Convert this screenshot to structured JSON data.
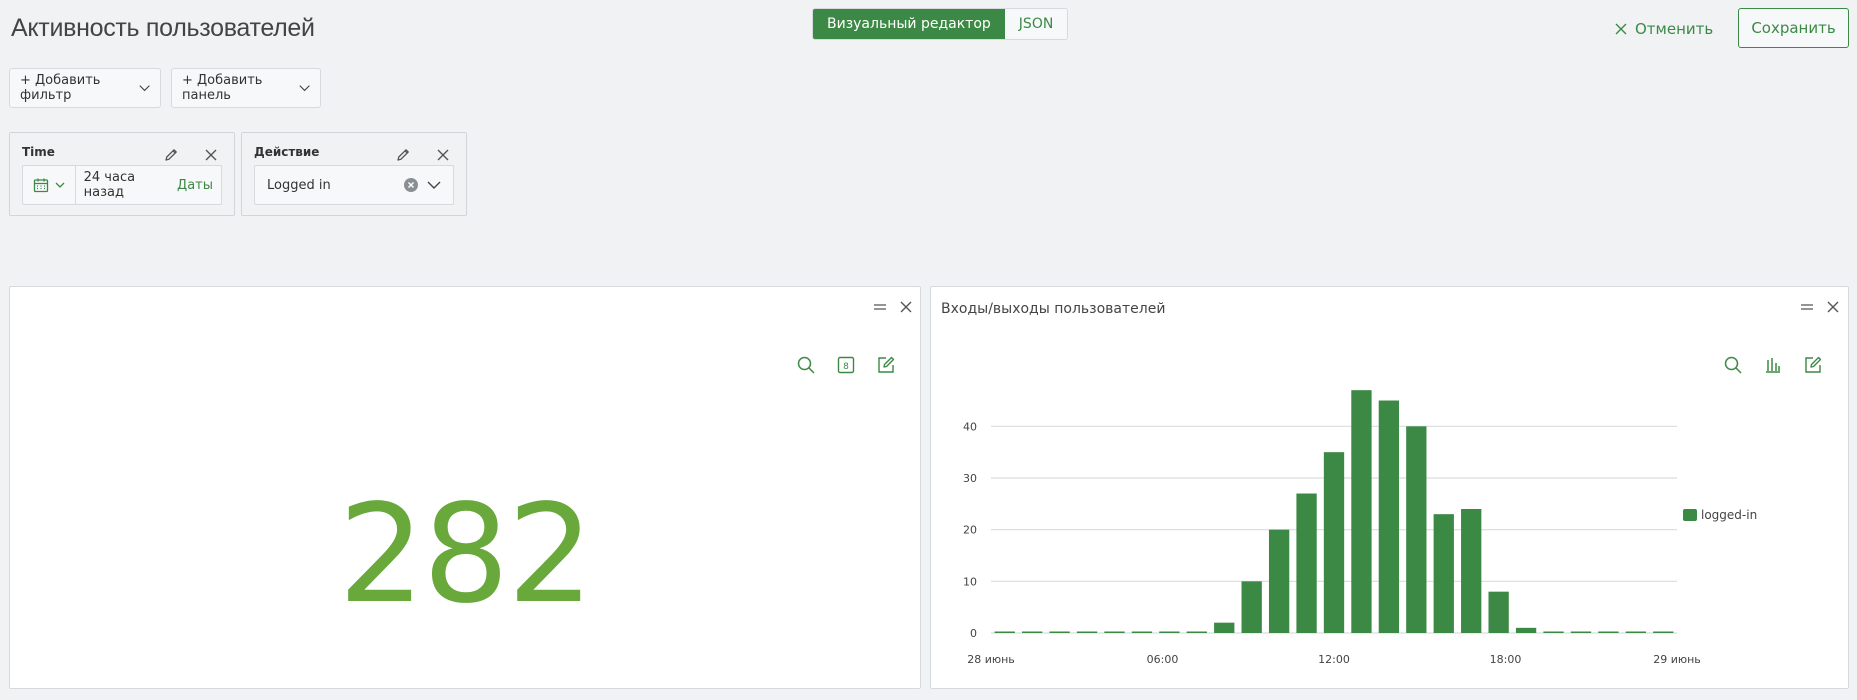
{
  "header": {
    "title": "Активность пользователей",
    "mode_visual": "Визуальный редактор",
    "mode_json": "JSON",
    "cancel_label": "Отменить",
    "save_label": "Сохранить"
  },
  "toolbar": {
    "add_filter": "+ Добавить фильтр",
    "add_panel": "+ Добавить панель"
  },
  "filters": [
    {
      "label": "Time",
      "value": "24 часа назад",
      "link": "Даты"
    },
    {
      "label": "Действие",
      "value": "Logged in"
    }
  ],
  "panels": {
    "counter": {
      "value": "282"
    },
    "chart": {
      "title": "Входы/выходы пользователей"
    }
  },
  "colors": {
    "accent": "#3c8945",
    "number": "#69a83b",
    "bar": "#3c8945"
  },
  "chart_data": {
    "type": "bar",
    "title": "Входы/выходы пользователей",
    "x_tick_labels": [
      "28 июнь",
      "06:00",
      "12:00",
      "18:00",
      "29 июнь"
    ],
    "y_ticks": [
      0,
      10,
      20,
      30,
      40
    ],
    "ylim": [
      0,
      48
    ],
    "grid": true,
    "legend_position": "right",
    "series": [
      {
        "name": "logged-in",
        "values": [
          0,
          0,
          0,
          0,
          0,
          0,
          0,
          0,
          2,
          10,
          20,
          27,
          35,
          47,
          45,
          40,
          23,
          24,
          8,
          1,
          0,
          0,
          0,
          0,
          0
        ]
      }
    ]
  }
}
